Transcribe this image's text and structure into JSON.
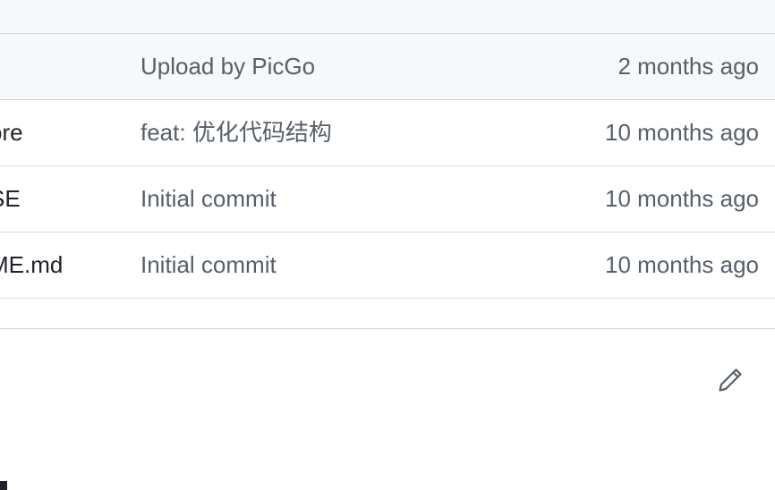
{
  "file_list": {
    "rows": [
      {
        "name": "",
        "message": "Upload by PicGo",
        "age": "2 months ago",
        "highlight": true
      },
      {
        "name": "ore",
        "message": "feat: 优化代码结构",
        "age": "10 months ago"
      },
      {
        "name": "SE",
        "message": "Initial commit",
        "age": "10 months ago"
      },
      {
        "name": "ME.md",
        "message": "Initial commit",
        "age": "10 months ago"
      }
    ]
  },
  "readme": {
    "title": "d",
    "edit_icon": "pencil-icon"
  },
  "colors": {
    "header_bg": "#f6f8fa",
    "border": "#d0d7de",
    "muted_text": "#57606a",
    "primary_text": "#1f2328"
  }
}
